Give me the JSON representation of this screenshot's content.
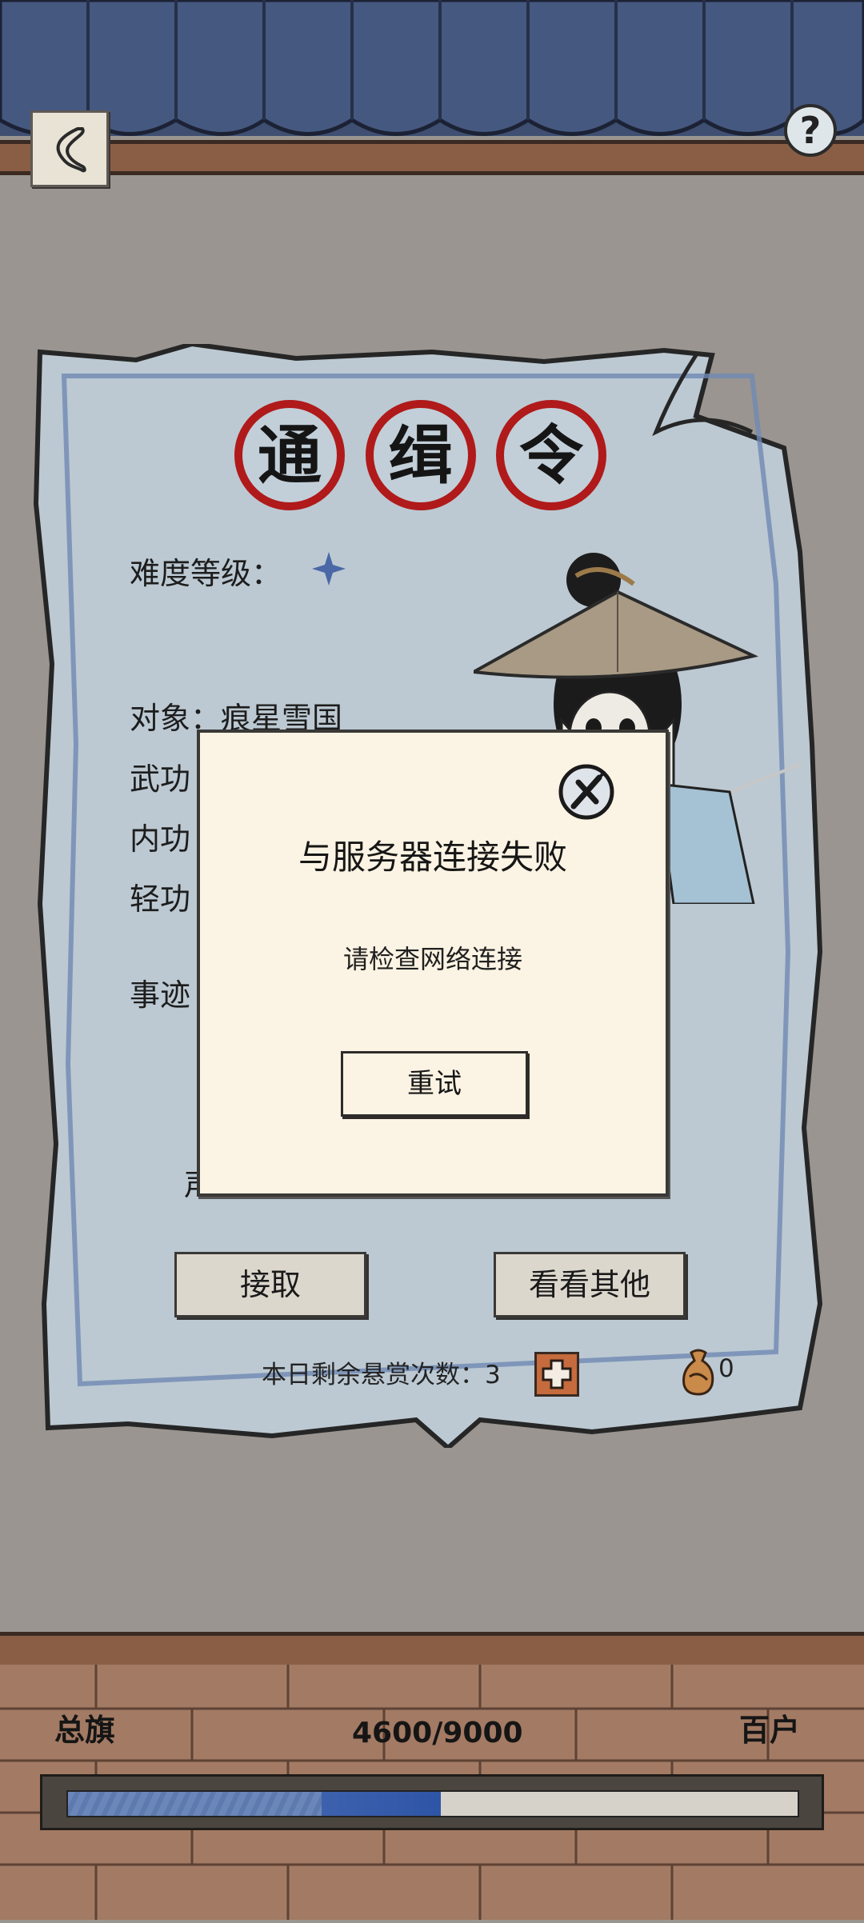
{
  "header": {
    "back_icon": "chevron-left-icon",
    "help_icon": "question-mark-icon",
    "help_label": "?"
  },
  "poster": {
    "seal_chars": [
      "通",
      "缉",
      "令"
    ],
    "difficulty_label": "难度等级：",
    "difficulty_icon": "star-icon",
    "target_line": "对象：痕星雪国",
    "partial_labels": [
      "武功",
      "内功",
      "轻功",
      "事迹"
    ],
    "partial_fragment": "声",
    "accept_label": "接取",
    "others_label": "看看其他",
    "remaining_label": "本日剩余悬赏次数：",
    "remaining_count": "3",
    "add_icon": "plus-icon",
    "token_icon": "coin-pouch-icon",
    "token_count": "0"
  },
  "footer": {
    "rank_current": "总旗",
    "rank_next": "百户",
    "progress_text": "4600/9000",
    "progress_fraction": 0.511
  },
  "dialog": {
    "close_icon": "close-icon",
    "title": "与服务器连接失败",
    "message": "请检查网络连接",
    "retry_label": "重试"
  },
  "colors": {
    "seal_red": "#b01a1a",
    "progress_blue": "#2e55a6",
    "dialog_bg": "#fbf3e3"
  }
}
